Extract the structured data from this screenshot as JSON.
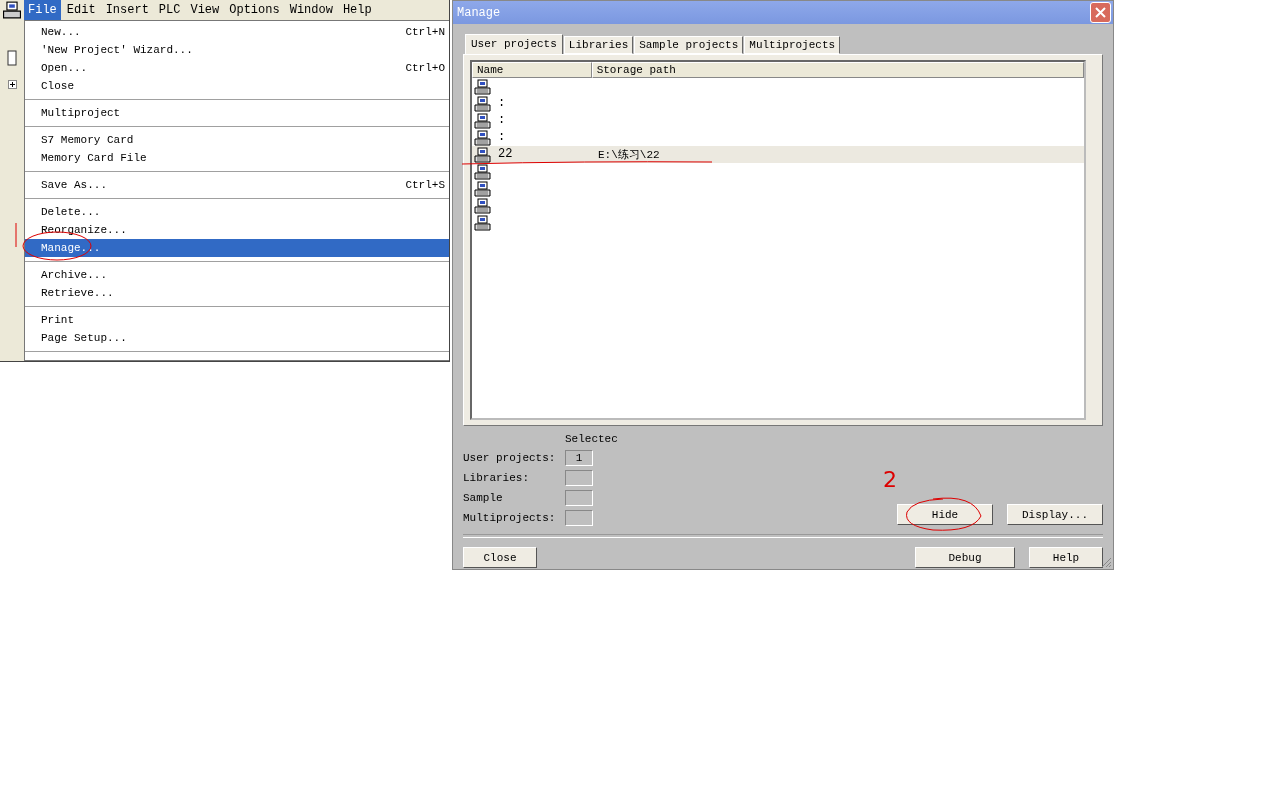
{
  "menu_bar": [
    {
      "label": "File",
      "selected": true
    },
    {
      "label": "Edit",
      "selected": false
    },
    {
      "label": "Insert",
      "selected": false
    },
    {
      "label": "PLC",
      "selected": false
    },
    {
      "label": "View",
      "selected": false
    },
    {
      "label": "Options",
      "selected": false
    },
    {
      "label": "Window",
      "selected": false
    },
    {
      "label": "Help",
      "selected": false
    }
  ],
  "file_menu": [
    [
      {
        "label": "New...",
        "shortcut": "Ctrl+N",
        "selected": false
      },
      {
        "label": "'New Project' Wizard...",
        "selected": false
      },
      {
        "label": "Open...",
        "shortcut": "Ctrl+O",
        "selected": false
      },
      {
        "label": "Close",
        "selected": false
      }
    ],
    [
      {
        "label": "Multiproject",
        "selected": false
      }
    ],
    [
      {
        "label": "S7 Memory Card",
        "selected": false
      },
      {
        "label": "Memory Card File",
        "selected": false
      }
    ],
    [
      {
        "label": "Save As...",
        "shortcut": "Ctrl+S",
        "selected": false
      }
    ],
    [
      {
        "label": "Delete...",
        "selected": false
      },
      {
        "label": "Reorganize...",
        "selected": false
      },
      {
        "label": "Manage...",
        "selected": true,
        "circled": true,
        "side_stroke": true
      }
    ],
    [
      {
        "label": "Archive...",
        "selected": false
      },
      {
        "label": "Retrieve...",
        "selected": false
      }
    ],
    [
      {
        "label": "Print",
        "selected": false
      },
      {
        "label": "Page Setup...",
        "selected": false
      }
    ]
  ],
  "dialog": {
    "title": "Manage",
    "tabs": [
      {
        "label": "User projects",
        "selected": true
      },
      {
        "label": "Libraries",
        "selected": false
      },
      {
        "label": "Sample projects",
        "selected": false
      },
      {
        "label": "Multiprojects",
        "selected": false
      }
    ],
    "columns": [
      "Name",
      "Storage path"
    ],
    "rows": [
      {
        "selected": false
      },
      {
        "name": ":",
        "selected": false
      },
      {
        "name": ":",
        "selected": false
      },
      {
        "name": ":",
        "selected": false
      },
      {
        "name": "22",
        "path": "E:\\练习\\22",
        "selected": true,
        "underlined": true
      },
      {
        "selected": false
      },
      {
        "selected": false
      },
      {
        "selected": false
      },
      {
        "selected": false
      }
    ],
    "counts_header": "Selectec",
    "counts": [
      {
        "label": "User projects:",
        "value": "1"
      },
      {
        "label": "Libraries:"
      },
      {
        "label": "Sample"
      },
      {
        "label": "Multiprojects:"
      }
    ],
    "actions": [
      {
        "label": "Hide",
        "circled": true,
        "note": "2"
      },
      {
        "label": "Display..."
      }
    ],
    "footer_left": [
      {
        "label": "Close"
      }
    ],
    "footer_right": [
      {
        "label": "Debug"
      },
      {
        "label": "Help"
      }
    ]
  }
}
